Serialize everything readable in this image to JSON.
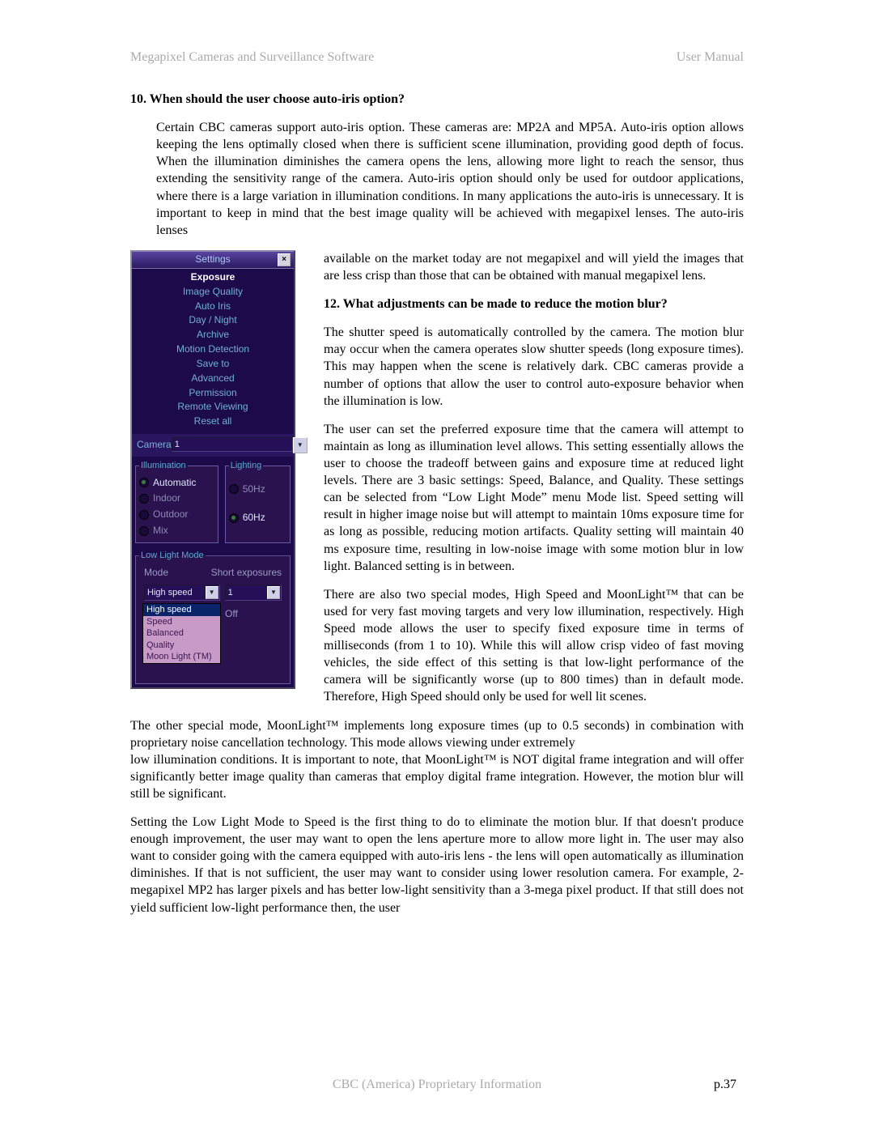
{
  "header": {
    "left": "Megapixel Cameras and Surveillance Software",
    "right": "User Manual"
  },
  "footer": {
    "center": "CBC (America) Proprietary Information",
    "page": "p.37"
  },
  "body": {
    "h10": "10.  When should the user choose auto-iris option?",
    "p10a": "Certain CBC cameras support auto-iris option. These cameras are: MP2A and MP5A.  Auto-iris option allows keeping the lens optimally closed when there is sufficient scene illumination, providing good depth of focus. When the illumination diminishes the camera opens the lens, allowing more light to reach the sensor, thus extending the sensitivity range of the camera. Auto-iris option should only be used for outdoor applications, where there is a large variation in illumination conditions. In many applications the auto-iris is unnecessary. It is important to keep in mind that the best image quality will be achieved with megapixel lenses. The auto-iris lenses",
    "p10b": "available on the market today are not megapixel and will yield the images that are less crisp than those that can be obtained with manual megapixel lens.",
    "h12": "12.  What adjustments can be made to reduce the motion blur?",
    "p12a": "The shutter speed is automatically controlled by the camera. The motion blur may occur when the camera operates slow shutter speeds (long exposure times).  This may happen when the scene is relatively dark. CBC cameras provide a number of options that allow the user to control auto-exposure behavior when the illumination is low.",
    "p12b": "The user can set the preferred exposure time that the camera will attempt to maintain as long as illumination level allows. This setting essentially allows the user to choose the tradeoff between gains and exposure time at reduced light levels. There are 3 basic settings: Speed, Balance, and Quality. These settings can be selected from “Low Light Mode” menu Mode list.  Speed setting will result in higher image noise but will attempt to maintain 10ms exposure time for as long as possible, reducing motion artifacts. Quality setting will maintain 40 ms exposure time, resulting in low-noise image with some motion blur in low light. Balanced setting is in between.",
    "p12c": "There are also two special modes, High Speed and MoonLight™ that can be used for very fast moving targets and very low illumination, respectively. High Speed mode allows the user to specify fixed exposure time in terms of milliseconds (from 1 to 10). While this will allow crisp video of fast moving vehicles, the side effect of this setting is that low-light performance of the camera will be significantly worse (up to 800 times) than in default mode. Therefore, High Speed should only be used for well lit scenes.",
    "p12d": "The other special mode, MoonLight™ implements long exposure times (up to 0.5 seconds) in combination with proprietary noise cancellation technology. This mode allows viewing under extremely",
    "p12d2": "low illumination conditions. It is important to note, that MoonLight™ is NOT digital frame integration and will offer significantly better image quality than cameras that employ digital frame integration. However, the motion blur will still be significant.",
    "p12e": "Setting the Low Light Mode to Speed is the first thing to do to eliminate the motion blur. If that doesn't produce enough improvement, the user may want to open the lens aperture more to allow more light in. The user may also want to consider going with the camera equipped with auto-iris lens - the lens will open automatically as illumination diminishes. If that is not sufficient, the user may want to consider using lower resolution camera. For example, 2-megapixel MP2 has larger pixels and has better low-light sensitivity than a 3-mega pixel product.  If that still does not yield sufficient low-light performance then, the user"
  },
  "ui": {
    "title": "Settings",
    "menu": [
      "Exposure",
      "Image Quality",
      "Auto Iris",
      "Day / Night",
      "Archive",
      "Motion Detection",
      "Save to",
      "Advanced",
      "Permission",
      "Remote Viewing",
      "Reset all"
    ],
    "camera": {
      "label": "Camera",
      "value": "1"
    },
    "illum": {
      "legend": "Illumination",
      "opts": [
        "Automatic",
        "Indoor",
        "Outdoor",
        "Mix"
      ]
    },
    "light": {
      "legend": "Lighting",
      "opts": [
        "50Hz",
        "60Hz"
      ]
    },
    "low": {
      "legend": "Low Light Mode",
      "mode_label": "Mode",
      "short_label": "Short exposures",
      "mode_value": "High speed",
      "short_value": "1",
      "options": [
        "High speed",
        "Speed",
        "Balanced",
        "Quality",
        "Moon Light (TM)"
      ],
      "off": "Off"
    }
  }
}
